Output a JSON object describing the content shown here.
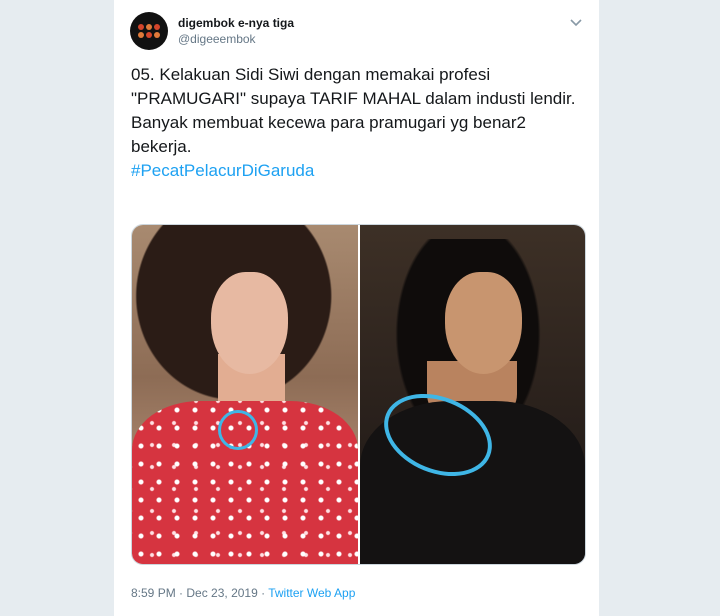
{
  "tweet": {
    "display_name": "digembok e-nya tiga",
    "handle": "@digeeembok",
    "text": "05. Kelakuan Sidi Siwi dengan memakai profesi \"PRAMUGARI\" supaya TARIF MAHAL dalam industi lendir.\nBanyak membuat kecewa para pramugari yg benar2 bekerja.",
    "hashtag": "#PecatPelacurDiGaruda",
    "time": "8:59 PM",
    "separator1": " · ",
    "date": "Dec 23, 2019",
    "separator2": " · ",
    "source": "Twitter Web App"
  },
  "icons": {
    "menu": "chevron-down-icon"
  },
  "colors": {
    "link": "#1da1f2",
    "text": "#14171a",
    "secondary": "#657786",
    "highlight_circle": "#3fb6e6"
  }
}
